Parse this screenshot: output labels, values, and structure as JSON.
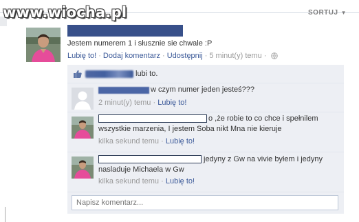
{
  "watermark": {
    "text": "www.wiocha.pl"
  },
  "header": {
    "sort_label": "SORTUJ"
  },
  "post": {
    "text": "Jestem numerem 1 i słusznie sie chwale :P",
    "actions": {
      "like": "Lubię to!",
      "sep1": "·",
      "comment": "Dodaj komentarz",
      "sep2": "·",
      "share": "Udostępnij",
      "sep3": "·",
      "time": "5 minut(y) temu",
      "sep4": "·"
    }
  },
  "likes": {
    "text": "lubi to."
  },
  "comments": [
    {
      "text": "w czym numer jeden jesteś???",
      "time": "2 minut(y) temu",
      "sep": "·",
      "like": "Lubię to!"
    },
    {
      "text_line1": "o ,że robie to co chce i spełnilem",
      "text_line2": "wszystkie marzenia, I jestem Soba nikt Mna nie kieruje",
      "time": "kilka sekund temu",
      "sep": "·",
      "like": "Lubię to!"
    },
    {
      "text_line1": "jedyny z Gw na vivie byłem i jedyny",
      "text_line2": "nasladuje Michaela w Gw",
      "time": "kilka sekund temu",
      "sep": "·",
      "like": "Lubię to!"
    }
  ],
  "composer": {
    "placeholder": "Napisz komentarz..."
  },
  "colors": {
    "link": "#3b5998",
    "thread_bg": "#edeff4",
    "redaction": "#38508a"
  }
}
